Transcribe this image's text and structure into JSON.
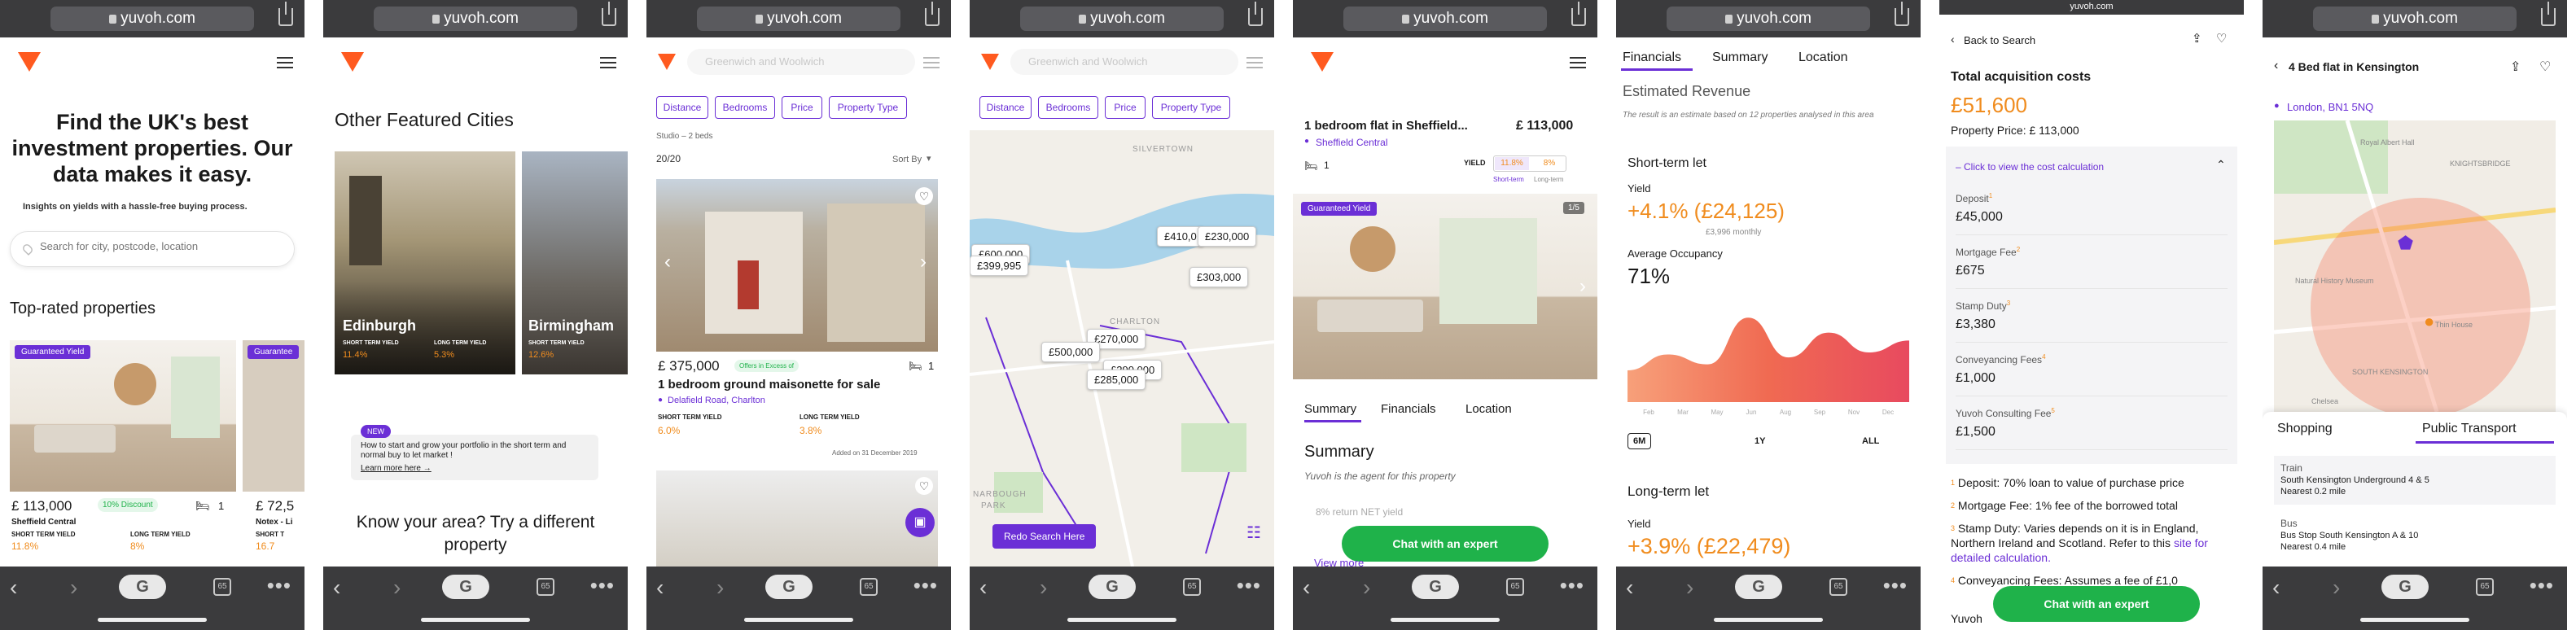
{
  "browser": {
    "url": "yuvoh.com",
    "url_small": "yuvoh.com"
  },
  "s1": {
    "hero_title": "Find the UK's best investment properties. Our data makes it easy.",
    "hero_sub": "Insights on yields with a hassle-free buying process.",
    "search_placeholder": "Search for city, postcode, location",
    "section_title": "Top-rated properties",
    "badge": "Guaranteed Yield",
    "badge2": "Guarantee",
    "price": "£ 113,000",
    "discount": "10% Discount",
    "beds": "1",
    "location": "Sheffield Central",
    "stl_label": "SHORT TERM YIELD",
    "ltl_label": "LONG TERM YIELD",
    "stl": "11.8%",
    "ltl": "8%",
    "price2": "£ 72,5",
    "location2": "Notex - Li",
    "stl2_label": "SHORT T",
    "stl2": "16.7"
  },
  "s2": {
    "title": "Other Featured Cities",
    "city1": "Edinburgh",
    "city1_stl_label": "SHORT TERM YIELD",
    "city1_ltl_label": "LONG TERM YIELD",
    "city1_stl": "11.4%",
    "city1_ltl": "5.3%",
    "city2": "Birmingham",
    "city2_stl_label": "SHORT TERM YIELD",
    "city2_stl": "12.6%",
    "new_badge": "NEW",
    "news_text": "How to start and grow your portfolio in the short term and normal buy to let market !",
    "news_link": "Learn more here →",
    "know_area": "Know your area? Try a different property"
  },
  "s3": {
    "search_value": "Greenwich and Woolwich",
    "filters": [
      "Distance",
      "Bedrooms",
      "Price",
      "Property Type"
    ],
    "subfilter": "Studio – 2 beds",
    "count": "20/20",
    "sort": "Sort By",
    "price": "£ 375,000",
    "offers": "Offers in Excess of",
    "beds": "1",
    "title": "1 bedroom ground maisonette for sale",
    "location": "Delafield Road, Charlton",
    "stl_label": "SHORT TERM YIELD",
    "ltl_label": "LONG TERM YIELD",
    "stl": "6.0%",
    "ltl": "3.8%",
    "added": "Added on 31 December 2019"
  },
  "s4": {
    "search_value": "Greenwich and Woolwich",
    "filters": [
      "Distance",
      "Bedrooms",
      "Price",
      "Property Type"
    ],
    "map_labels": [
      "SILVERTOWN",
      "CHARLTON",
      "NARBOUGH",
      "PARK"
    ],
    "prices": [
      "£399,995",
      "£410,0",
      "£230,000",
      "£303,000",
      "£270,000",
      "£500,000",
      "£290,000",
      "£285,000",
      "£600,000"
    ],
    "redo": "Redo Search Here"
  },
  "s5": {
    "title": "1 bedroom flat in Sheffield...",
    "price": "£ 113,000",
    "location": "Sheffield Central",
    "beds": "1",
    "yield_label": "YIELD",
    "yield_st": "11.8%",
    "yield_lt": "8%",
    "short_term": "Short-term",
    "long_term": "Long-term",
    "badge": "Guaranteed Yield",
    "counter": "1/5",
    "tabs": [
      "Summary",
      "Financials",
      "Location"
    ],
    "summary_title": "Summary",
    "agent": "Yuvoh is the agent for this property",
    "bullet": "8% return NET yield",
    "view_more": "View more",
    "chat": "Chat with an expert"
  },
  "s6": {
    "tabs": [
      "Financials",
      "Summary",
      "Location"
    ],
    "heading": "Estimated Revenue",
    "note": "The result is an estimate based on 12 properties analysed in this area",
    "st_title": "Short-term let",
    "yield_label": "Yield",
    "st_yield": "+4.1% (£24,125)",
    "st_monthly": "£3,996 monthly",
    "occ_label": "Average Occupancy",
    "occ": "71%",
    "months": [
      "Feb",
      "Mar",
      "May",
      "Jun",
      "Aug",
      "Sep",
      "Nov",
      "Dec"
    ],
    "ranges": [
      "6M",
      "1Y",
      "ALL"
    ],
    "lt_title": "Long-term let",
    "lt_yield_label": "Yield",
    "lt_yield": "+3.9% (£22,479)",
    "chart_data": {
      "type": "area",
      "title": "",
      "x": [
        "Feb",
        "Mar",
        "May",
        "Jun",
        "Aug",
        "Sep",
        "Nov",
        "Dec"
      ],
      "series": [
        {
          "values": [
            32,
            48,
            38,
            85,
            45,
            70,
            50,
            62
          ]
        }
      ],
      "ylim": [
        0,
        100
      ],
      "grid": false,
      "legend": "none"
    }
  },
  "s7": {
    "back": "Back to Search",
    "total_label": "Total acquisition costs",
    "total": "£51,600",
    "property_price": "Property Price: £ 113,000",
    "toggle": "– Click to view the cost calculation",
    "costs": [
      {
        "label": "Deposit",
        "sup": "1",
        "value": "£45,000"
      },
      {
        "label": "Mortgage Fee",
        "sup": "2",
        "value": "£675"
      },
      {
        "label": "Stamp Duty",
        "sup": "3",
        "value": "£3,380"
      },
      {
        "label": "Conveyancing Fees",
        "sup": "4",
        "value": "£1,000"
      },
      {
        "label": "Yuvoh Consulting Fee",
        "sup": "5",
        "value": "£1,500"
      }
    ],
    "notes": [
      "Deposit: 70% loan to value of purchase price",
      "Mortgage Fee: 1% fee of the borrowed total",
      "Stamp Duty: Varies depends on it is in England, Northern Ireland and Scotland. Refer to this",
      "Conveyancing Fees: Assumes a fee of £1,0",
      "Yuvoh"
    ],
    "note_link": "site for detailed calculation.",
    "chat": "Chat with an expert"
  },
  "s8": {
    "title": "4 Bed flat in Kensington",
    "location": "London, BN1 5NQ",
    "tabs": [
      "Shopping",
      "Public Transport"
    ],
    "map_labels": [
      "Royal Albert Hall",
      "KNIGHTSBRIDGE",
      "Natural History Museum",
      "Thin House",
      "SOUTH KENSINGTON",
      "Chelsea"
    ],
    "train_label": "Train",
    "train_line1": "South Kensington Underground 4 & 5",
    "train_line2": "Nearest 0.2 mile",
    "bus_label": "Bus",
    "bus_line1": "Bus Stop South Kensington A & 10",
    "bus_line2": "Nearest 0.4 mile"
  },
  "colors": {
    "accent": "#6b2fd6",
    "orange": "#f08c1e",
    "green": "#1fb24a",
    "brand": "#ff5a1f"
  }
}
